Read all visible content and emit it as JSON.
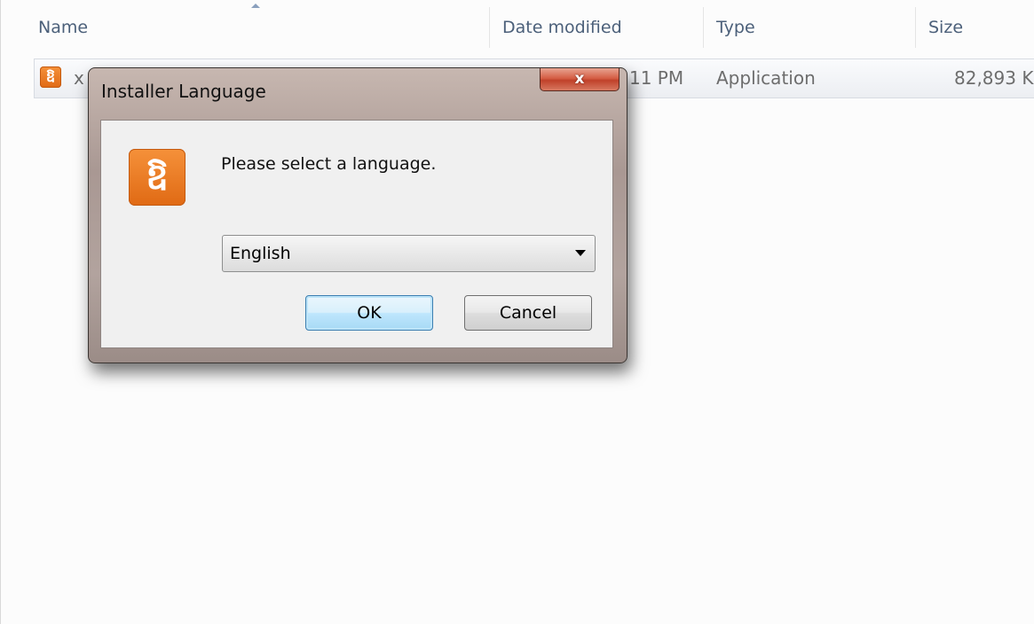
{
  "explorer": {
    "columns": {
      "name": "Name",
      "date_modified": "Date modified",
      "type": "Type",
      "size": "Size"
    },
    "file": {
      "name_partial": "x",
      "date_partial": "11 PM",
      "type": "Application",
      "size": "82,893 K"
    }
  },
  "dialog": {
    "title": "Installer Language",
    "close_label": "x",
    "logo_glyph": "ឱ",
    "prompt": "Please select a language.",
    "language_selected": "English",
    "ok_label": "OK",
    "cancel_label": "Cancel"
  },
  "colors": {
    "xampp_orange": "#f07d26",
    "header_text": "#4c607a",
    "default_button_border": "#3c7fb1"
  }
}
